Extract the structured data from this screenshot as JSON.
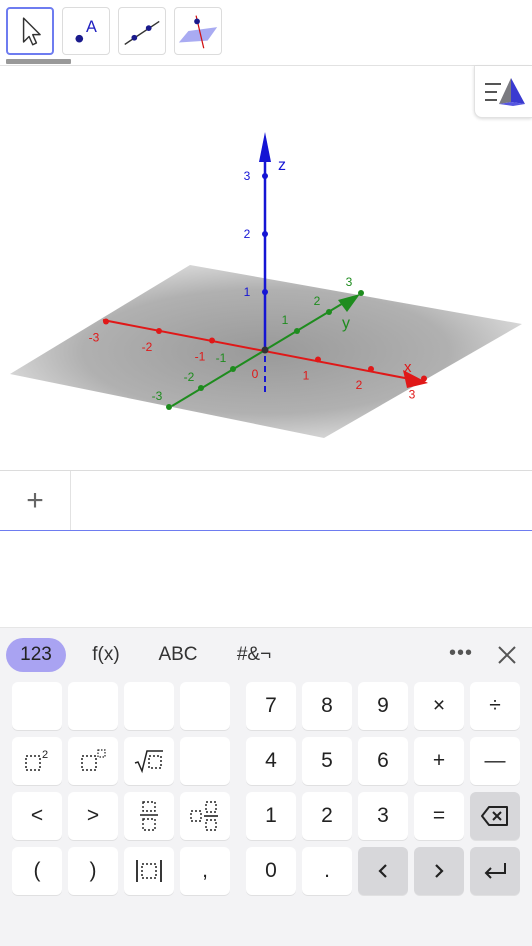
{
  "toolbar": {
    "tools": [
      {
        "name": "move-tool",
        "icon": "arrow-cursor-icon",
        "active": true
      },
      {
        "name": "point-tool",
        "icon": "point-icon",
        "label": "A"
      },
      {
        "name": "line-tool",
        "icon": "line-through-points-icon"
      },
      {
        "name": "plane-tool",
        "icon": "plane-icon"
      }
    ]
  },
  "graphics": {
    "view_menu_icon": "view-menu-pyramid-icon",
    "axes": {
      "x": {
        "label": "x",
        "color": "#e01818",
        "ticks": [
          "-3",
          "-2",
          "-1",
          "0",
          "1",
          "2",
          "3"
        ]
      },
      "y": {
        "label": "y",
        "color": "#1e8c1e",
        "ticks": [
          "-3",
          "-2",
          "-1",
          "0",
          "1",
          "2",
          "3"
        ]
      },
      "z": {
        "label": "z",
        "color": "#1515d4",
        "ticks": [
          "1",
          "2",
          "3"
        ]
      }
    },
    "origin_label": "0"
  },
  "algebra": {
    "add_label": "+",
    "input_value": ""
  },
  "keyboard": {
    "tabs": [
      "123",
      "f(x)",
      "ABC",
      "#&¬"
    ],
    "active_tab": "123",
    "more_label": "•••",
    "close_icon": "close-icon",
    "keys": {
      "n7": "7",
      "n8": "8",
      "n9": "9",
      "times": "×",
      "divide": "÷",
      "n4": "4",
      "n5": "5",
      "n6": "6",
      "plus": "+",
      "minus": "—",
      "lt": "<",
      "gt": ">",
      "n1": "1",
      "n2": "2",
      "n3": "3",
      "equals": "=",
      "lparen": "(",
      "rparen": ")",
      "comma": ",",
      "n0": "0",
      "dot": "."
    },
    "special_keys": {
      "square": "square-icon",
      "power": "power-icon",
      "sqrt": "sqrt-icon",
      "fraction": "fraction-icon",
      "mixed": "mixed-fraction-icon",
      "abs": "abs-icon",
      "backspace": "backspace-icon",
      "left": "arrow-left-icon",
      "right": "arrow-right-icon",
      "enter": "enter-icon"
    }
  }
}
